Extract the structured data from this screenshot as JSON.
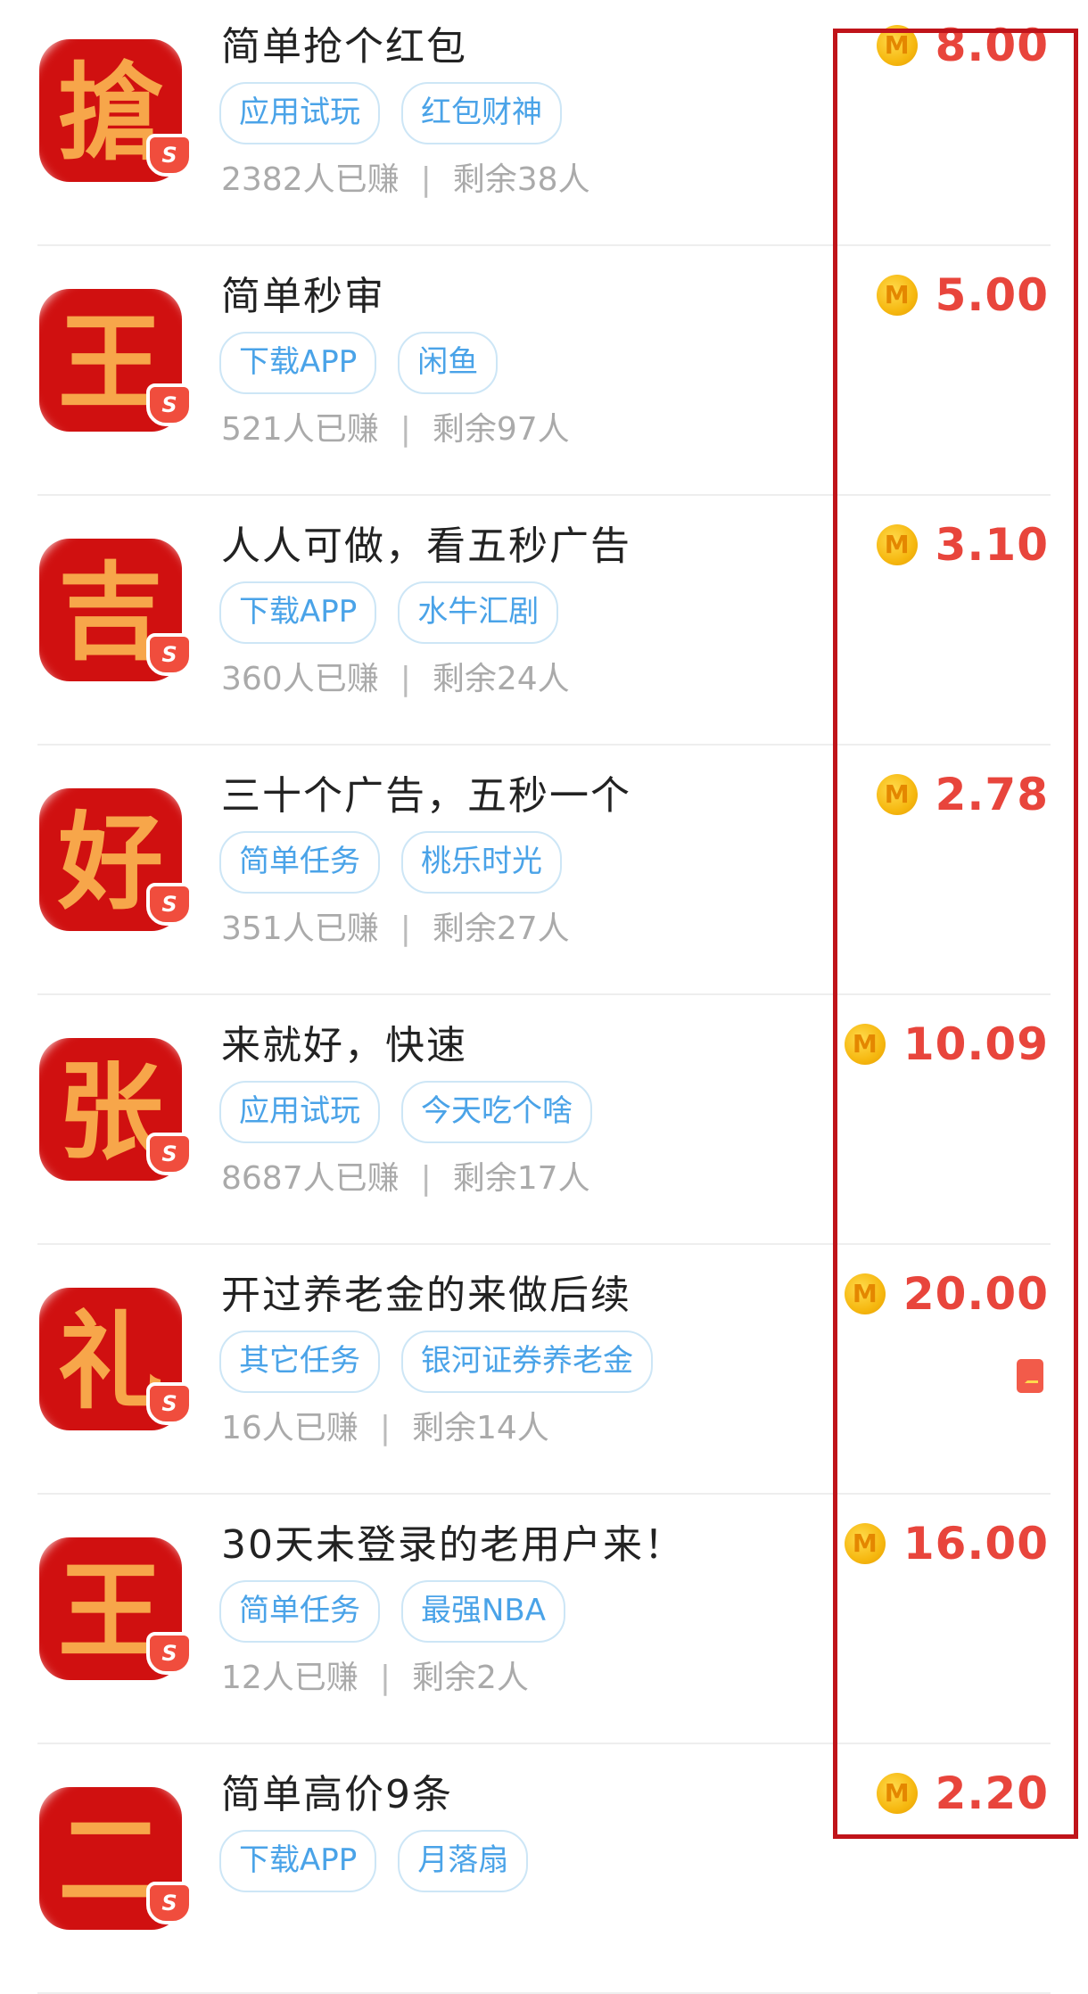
{
  "tasks": [
    {
      "title": "简单抢个红包",
      "tags": [
        "应用试玩",
        "红包财神"
      ],
      "earned": "2382人已赚",
      "remaining": "剩余38人",
      "reward": "8.00",
      "icon_glyph": "搶"
    },
    {
      "title": "简单秒审",
      "tags": [
        "下载APP",
        "闲鱼"
      ],
      "earned": "521人已赚",
      "remaining": "剩余97人",
      "reward": "5.00",
      "icon_glyph": "王"
    },
    {
      "title": "人人可做，看五秒广告",
      "tags": [
        "下载APP",
        "水牛汇剧"
      ],
      "earned": "360人已赚",
      "remaining": "剩余24人",
      "reward": "3.10",
      "icon_glyph": "吉"
    },
    {
      "title": "三十个广告，五秒一个",
      "tags": [
        "简单任务",
        "桃乐时光"
      ],
      "earned": "351人已赚",
      "remaining": "剩余27人",
      "reward": "2.78",
      "icon_glyph": "好"
    },
    {
      "title": "来就好，快速",
      "tags": [
        "应用试玩",
        "今天吃个啥"
      ],
      "earned": "8687人已赚",
      "remaining": "剩余17人",
      "reward": "10.09",
      "icon_glyph": "张"
    },
    {
      "title": "开过养老金的来做后续",
      "tags": [
        "其它任务",
        "银河证券养老金"
      ],
      "earned": "16人已赚",
      "remaining": "剩余14人",
      "reward": "20.00",
      "icon_glyph": "礼",
      "has_redpacket": true
    },
    {
      "title": "30天未登录的老用户来！",
      "tags": [
        "简单任务",
        "最强NBA"
      ],
      "earned": "12人已赚",
      "remaining": "剩余2人",
      "reward": "16.00",
      "icon_glyph": "王"
    },
    {
      "title": "简单高价9条",
      "tags": [
        "下载APP",
        "月落扇"
      ],
      "earned": "",
      "remaining": "",
      "reward": "2.20",
      "icon_glyph": "二"
    }
  ],
  "icons": {
    "coin": "M",
    "badge": "S",
    "separator": "|"
  },
  "colors": {
    "reward": "#e8453c",
    "tag_text": "#4aa3e8",
    "highlight_box": "#c0141a",
    "coin": "#f6b810"
  }
}
